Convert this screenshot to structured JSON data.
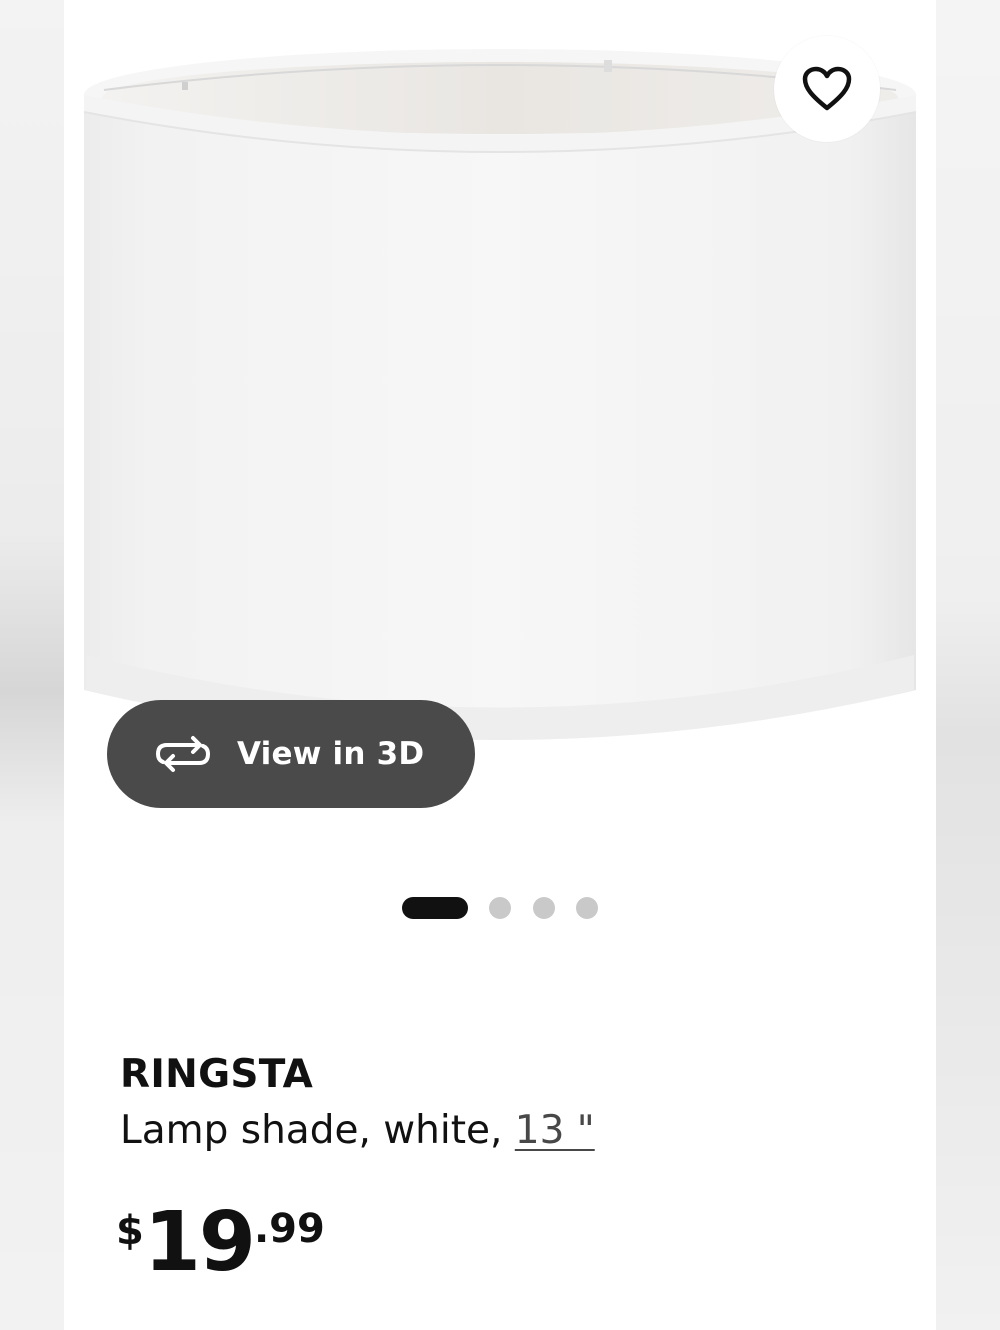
{
  "favorite": {
    "icon": "heart-icon"
  },
  "view3d": {
    "icon": "rotate-3d-icon",
    "label": "View in 3D"
  },
  "pager": {
    "count": 4,
    "active_index": 0
  },
  "product": {
    "name": "RINGSTA",
    "description_prefix": "Lamp shade, white, ",
    "size": "13 \"",
    "price": {
      "currency": "$",
      "integer": "19",
      "decimal": ".99"
    }
  },
  "colors": {
    "view3d_bg": "#4a4a4a",
    "active_dot": "#111111",
    "inactive_dot": "#c9c9c9"
  }
}
